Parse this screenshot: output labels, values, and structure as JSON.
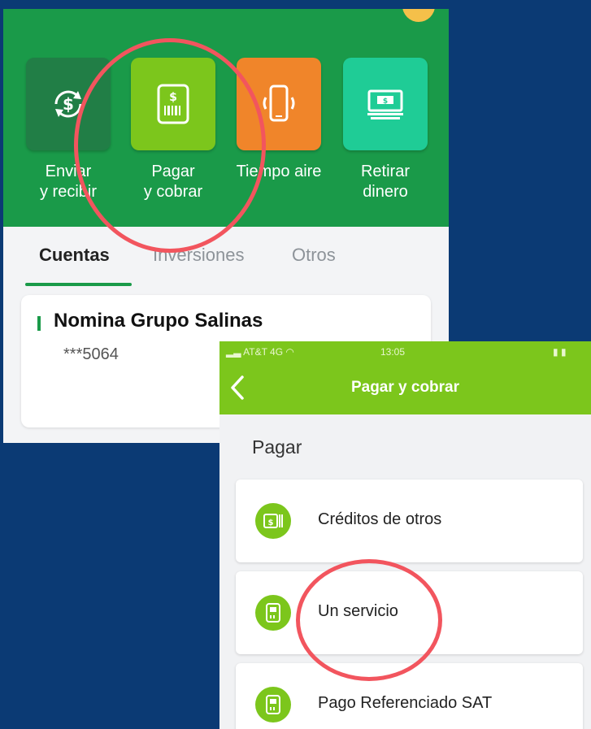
{
  "screen1": {
    "actions": [
      {
        "label_line1": "Enviar",
        "label_line2": "y recibir",
        "icon": "dollar-cycle-icon",
        "color": "#217e46"
      },
      {
        "label_line1": "Pagar",
        "label_line2": "y cobrar",
        "icon": "barcode-bill-icon",
        "color": "#7cc61c"
      },
      {
        "label_line1": "Tiempo aire",
        "label_line2": "",
        "icon": "phone-vibrate-icon",
        "color": "#f0852a"
      },
      {
        "label_line1": "Retirar",
        "label_line2": "dinero",
        "icon": "cash-withdraw-icon",
        "color": "#1fcc96"
      }
    ],
    "tabs": [
      "Cuentas",
      "Inversiones",
      "Otros"
    ],
    "active_tab": "Cuentas",
    "account": {
      "name": "Nomina Grupo Salinas",
      "number": "***5064"
    }
  },
  "screen2": {
    "status_bar": {
      "carrier": "AT&T 4G",
      "time": "13:05"
    },
    "title": "Pagar y cobrar",
    "section": "Pagar",
    "options": [
      {
        "label": "Créditos de otros",
        "icon": "credit-card-icon"
      },
      {
        "label": "Un servicio",
        "icon": "service-bill-icon"
      },
      {
        "label": "Pago Referenciado SAT",
        "icon": "sat-receipt-icon"
      }
    ]
  },
  "colors": {
    "header_green": "#1a9a49",
    "lime": "#7cc61c",
    "background": "#0b3a74",
    "highlight": "#f2555e"
  }
}
